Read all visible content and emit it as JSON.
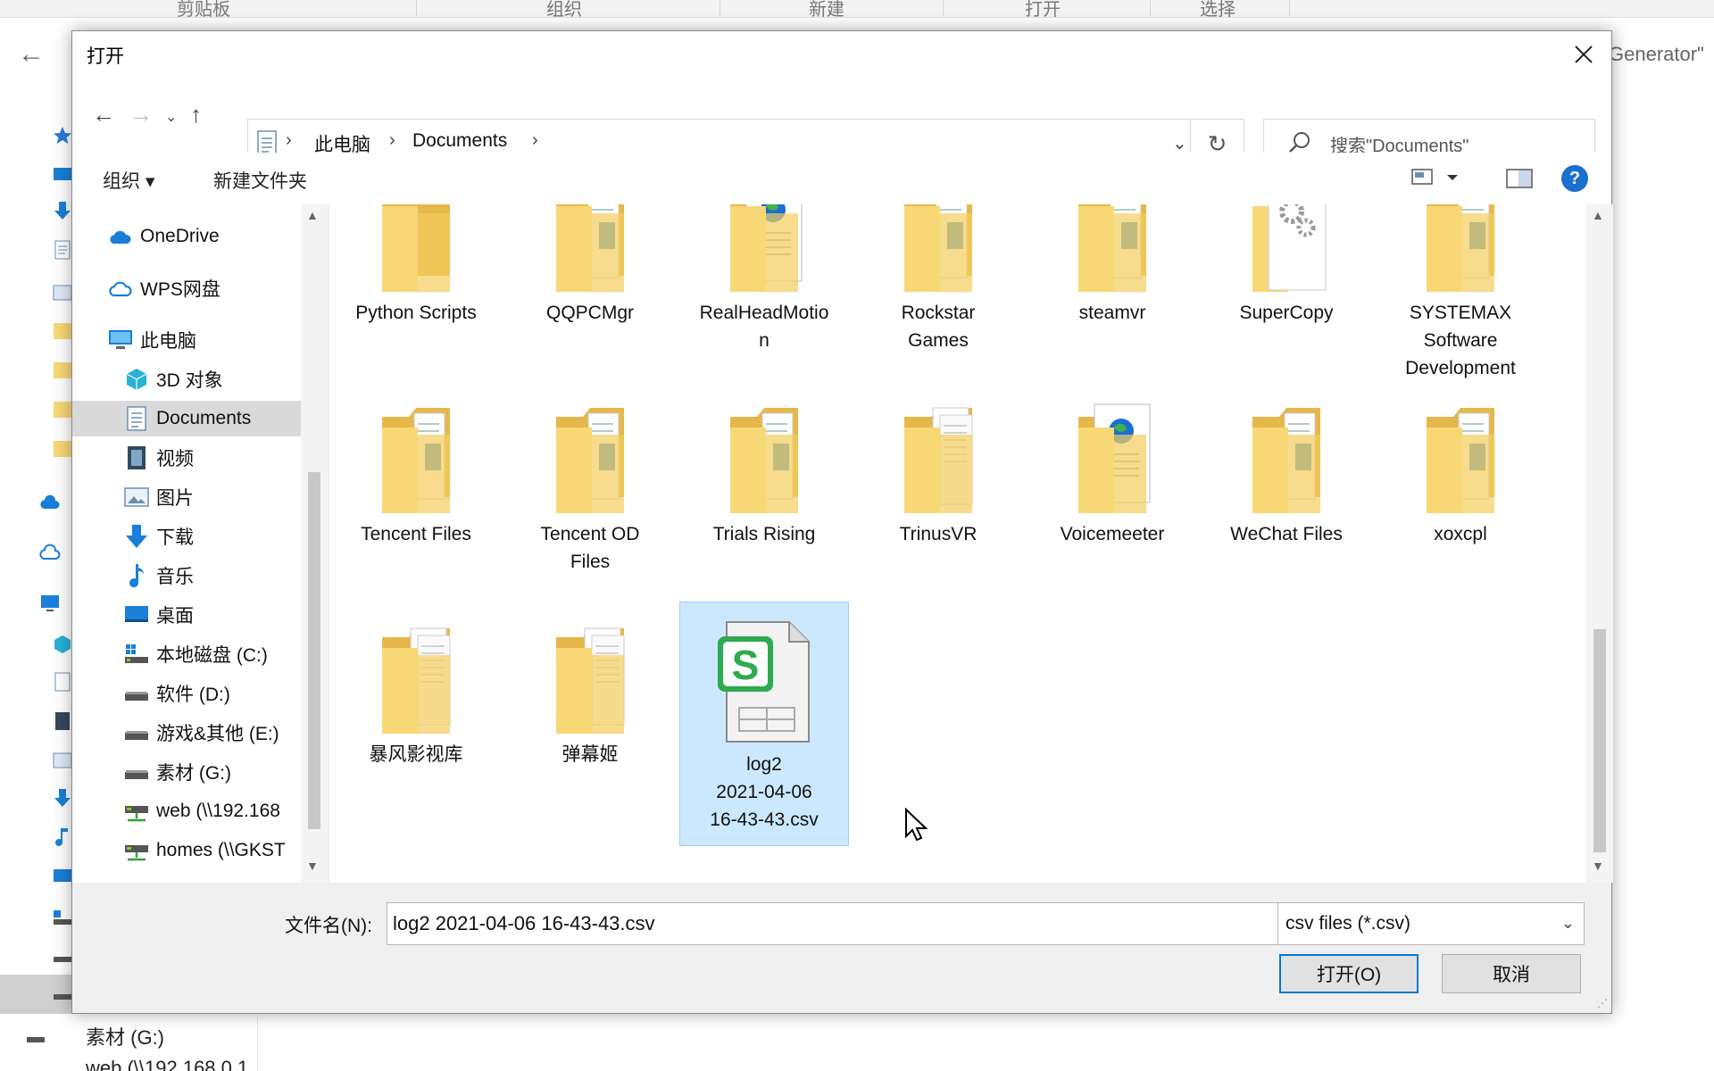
{
  "background_window": {
    "ribbon_groups": [
      "剪贴板",
      "组织",
      "新建",
      "打开",
      "选择"
    ],
    "right_partial_text": "Generator\"",
    "bottom_drive_label": "素材 (G:)",
    "bottom_partial_label": "web (\\\\192.168.0.1"
  },
  "dialog": {
    "title": "打开",
    "breadcrumbs": [
      "此电脑",
      "Documents"
    ],
    "search_placeholder": "搜索\"Documents\"",
    "command_bar": {
      "organize": "组织 ▾",
      "new_folder": "新建文件夹"
    },
    "nav_pane": {
      "items": [
        {
          "label": "OneDrive",
          "icon": "onedrive-cloud-icon"
        },
        {
          "label": "WPS网盘",
          "icon": "wps-cloud-icon"
        },
        {
          "label": "此电脑",
          "icon": "this-pc-icon"
        },
        {
          "label": "3D 对象",
          "icon": "3d-objects-icon"
        },
        {
          "label": "Documents",
          "icon": "documents-icon",
          "selected": true
        },
        {
          "label": "视频",
          "icon": "videos-icon"
        },
        {
          "label": "图片",
          "icon": "pictures-icon"
        },
        {
          "label": "下载",
          "icon": "downloads-icon"
        },
        {
          "label": "音乐",
          "icon": "music-icon"
        },
        {
          "label": "桌面",
          "icon": "desktop-icon"
        },
        {
          "label": "本地磁盘 (C:)",
          "icon": "system-drive-icon"
        },
        {
          "label": "软件 (D:)",
          "icon": "drive-icon"
        },
        {
          "label": "游戏&其他 (E:)",
          "icon": "drive-icon"
        },
        {
          "label": "素材 (G:)",
          "icon": "drive-icon"
        },
        {
          "label": "web (\\\\192.168",
          "icon": "network-drive-icon"
        },
        {
          "label": "homes (\\\\GKST",
          "icon": "network-drive-icon"
        }
      ]
    },
    "files": [
      {
        "label": "Python Scripts",
        "icon": "folder-icon"
      },
      {
        "label": "QQPCMgr",
        "icon": "folder-with-files-icon"
      },
      {
        "label": "RealHeadMotion",
        "icon": "folder-html-icon"
      },
      {
        "label": "Rockstar Games",
        "icon": "folder-with-files-icon"
      },
      {
        "label": "steamvr",
        "icon": "folder-with-files-icon"
      },
      {
        "label": "SuperCopy",
        "icon": "folder-gears-icon"
      },
      {
        "label": "SYSTEMAX Software Development",
        "icon": "folder-with-files-icon"
      },
      {
        "label": "Tencent Files",
        "icon": "folder-with-files-icon"
      },
      {
        "label": "Tencent OD Files",
        "icon": "folder-with-files-icon"
      },
      {
        "label": "Trials Rising",
        "icon": "folder-with-files-icon"
      },
      {
        "label": "TrinusVR",
        "icon": "folder-documents-icon"
      },
      {
        "label": "Voicemeeter",
        "icon": "folder-html-icon"
      },
      {
        "label": "WeChat Files",
        "icon": "folder-with-files-icon"
      },
      {
        "label": "xoxcpl",
        "icon": "folder-with-files-icon"
      },
      {
        "label": "暴风影视库",
        "icon": "folder-documents-icon"
      },
      {
        "label": "弹幕姬",
        "icon": "folder-documents-icon"
      },
      {
        "label": "log2 2021-04-06 16-43-43.csv",
        "icon": "wps-spreadsheet-icon",
        "selected": true
      }
    ],
    "file_label_lines": {
      "RealHeadMotion": [
        "RealHeadMotio",
        "n"
      ],
      "Rockstar Games": [
        "Rockstar",
        "Games"
      ],
      "SYSTEMAX Software Development": [
        "SYSTEMAX",
        "Software",
        "Development"
      ],
      "Tencent OD Files": [
        "Tencent OD",
        "Files"
      ],
      "log2 2021-04-06 16-43-43.csv": [
        "log2",
        "2021-04-06",
        "16-43-43.csv"
      ]
    },
    "filename_label": "文件名(N):",
    "filename_value": "log2 2021-04-06 16-43-43.csv",
    "filetype_value": "csv files (*.csv)",
    "open_button": "打开(O)",
    "cancel_button": "取消"
  },
  "colors": {
    "accent": "#0078d7",
    "selection": "#cce8ff",
    "folder": "#f8d775",
    "wps_green": "#2eaa4f"
  }
}
